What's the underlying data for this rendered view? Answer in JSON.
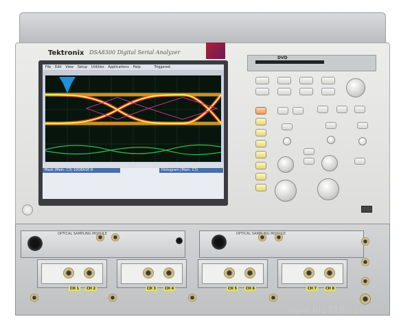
{
  "brand": {
    "logo": "Tektronix",
    "model": "DSA8300 Digital Serial Analyzer"
  },
  "drive": {
    "label": "DVD"
  },
  "screen": {
    "menu": [
      "File",
      "Edit",
      "View",
      "Setup",
      "Utilities",
      "Applications",
      "Help"
    ],
    "status_text": "Triggered",
    "meas_header_left": "Mask (Main: C3) 10GBASE-R",
    "meas_header_right": "Histogram (Main: C3)"
  },
  "modules": [
    {
      "label": "OPTICAL SAMPLING MODULE"
    },
    {
      "label": "OPTICAL SAMPLING MODULE"
    }
  ],
  "channels": [
    "CH 1",
    "CH 2",
    "CH 3",
    "CH 4",
    "CH 5",
    "CH 6",
    "CH 7",
    "CH 8"
  ],
  "watermark": "www.hl1718.com"
}
